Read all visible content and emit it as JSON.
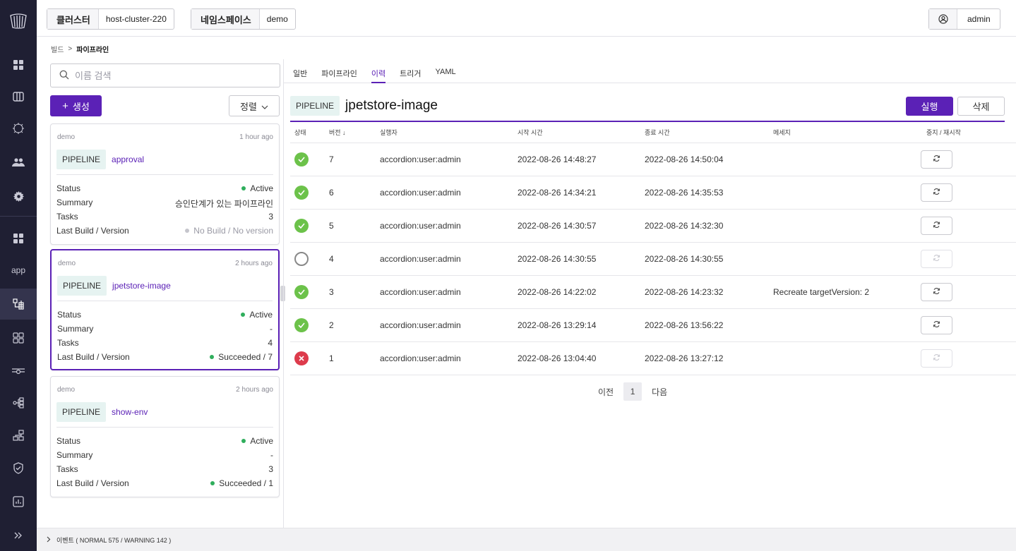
{
  "topbar": {
    "cluster_label": "클러스터",
    "cluster_value": "host-cluster-220",
    "namespace_label": "네임스페이스",
    "namespace_value": "demo",
    "user_name": "admin"
  },
  "rail": {
    "app_label": "app"
  },
  "breadcrumb": {
    "parent": "빌드",
    "separator": ">",
    "current": "파이프라인"
  },
  "list": {
    "search_placeholder": "이름 검색",
    "create_label": "생성",
    "sort_label": "정렬",
    "cards": [
      {
        "namespace": "demo",
        "age": "1 hour ago",
        "tag": "PIPELINE",
        "name": "approval",
        "status_key": "Status",
        "status_val": "Active",
        "summary_key": "Summary",
        "summary_val": "승인단계가 있는 파이프라인",
        "tasks_key": "Tasks",
        "tasks_val": "3",
        "build_key": "Last Build / Version",
        "build_val": "No Build / No version"
      },
      {
        "namespace": "demo",
        "age": "2 hours ago",
        "tag": "PIPELINE",
        "name": "jpetstore-image",
        "status_key": "Status",
        "status_val": "Active",
        "summary_key": "Summary",
        "summary_val": "-",
        "tasks_key": "Tasks",
        "tasks_val": "4",
        "build_key": "Last Build / Version",
        "build_val": "Succeeded / 7"
      },
      {
        "namespace": "demo",
        "age": "2 hours ago",
        "tag": "PIPELINE",
        "name": "show-env",
        "status_key": "Status",
        "status_val": "Active",
        "summary_key": "Summary",
        "summary_val": "-",
        "tasks_key": "Tasks",
        "tasks_val": "3",
        "build_key": "Last Build / Version",
        "build_val": "Succeeded / 1"
      }
    ]
  },
  "detail": {
    "tabs": [
      "일반",
      "파이프라인",
      "이력",
      "트리거",
      "YAML"
    ],
    "active_tab": "이력",
    "tag": "PIPELINE",
    "title": "jpetstore-image",
    "run_label": "실행",
    "delete_label": "삭제",
    "table": {
      "headers": {
        "status": "상태",
        "version": "버전 ↓",
        "actor": "실행자",
        "start": "시작 시간",
        "end": "종료 시간",
        "message": "메세지",
        "action": "중지 / 재시작"
      },
      "rows": [
        {
          "status": "succeeded",
          "version": "7",
          "actor": "accordion:user:admin",
          "start": "2022-08-26 14:48:27",
          "end": "2022-08-26 14:50:04",
          "message": ""
        },
        {
          "status": "succeeded",
          "version": "6",
          "actor": "accordion:user:admin",
          "start": "2022-08-26 14:34:21",
          "end": "2022-08-26 14:35:53",
          "message": ""
        },
        {
          "status": "succeeded",
          "version": "5",
          "actor": "accordion:user:admin",
          "start": "2022-08-26 14:30:57",
          "end": "2022-08-26 14:32:30",
          "message": ""
        },
        {
          "status": "pending",
          "version": "4",
          "actor": "accordion:user:admin",
          "start": "2022-08-26 14:30:55",
          "end": "2022-08-26 14:30:55",
          "message": ""
        },
        {
          "status": "succeeded",
          "version": "3",
          "actor": "accordion:user:admin",
          "start": "2022-08-26 14:22:02",
          "end": "2022-08-26 14:23:32",
          "message": "Recreate targetVersion: 2"
        },
        {
          "status": "succeeded",
          "version": "2",
          "actor": "accordion:user:admin",
          "start": "2022-08-26 13:29:14",
          "end": "2022-08-26 13:56:22",
          "message": ""
        },
        {
          "status": "failed",
          "version": "1",
          "actor": "accordion:user:admin",
          "start": "2022-08-26 13:04:40",
          "end": "2022-08-26 13:27:12",
          "message": ""
        }
      ]
    },
    "pager": {
      "prev": "이전",
      "page": "1",
      "next": "다음"
    }
  },
  "eventbar": {
    "label": "이벤트 ( NORMAL 575 / WARNING 142 )"
  },
  "colors": {
    "accent": "#5b21b6",
    "success": "#6cc24a",
    "active_dot": "#2fae5c",
    "danger": "#dd3b4c",
    "rail_bg": "#1f1f33"
  }
}
